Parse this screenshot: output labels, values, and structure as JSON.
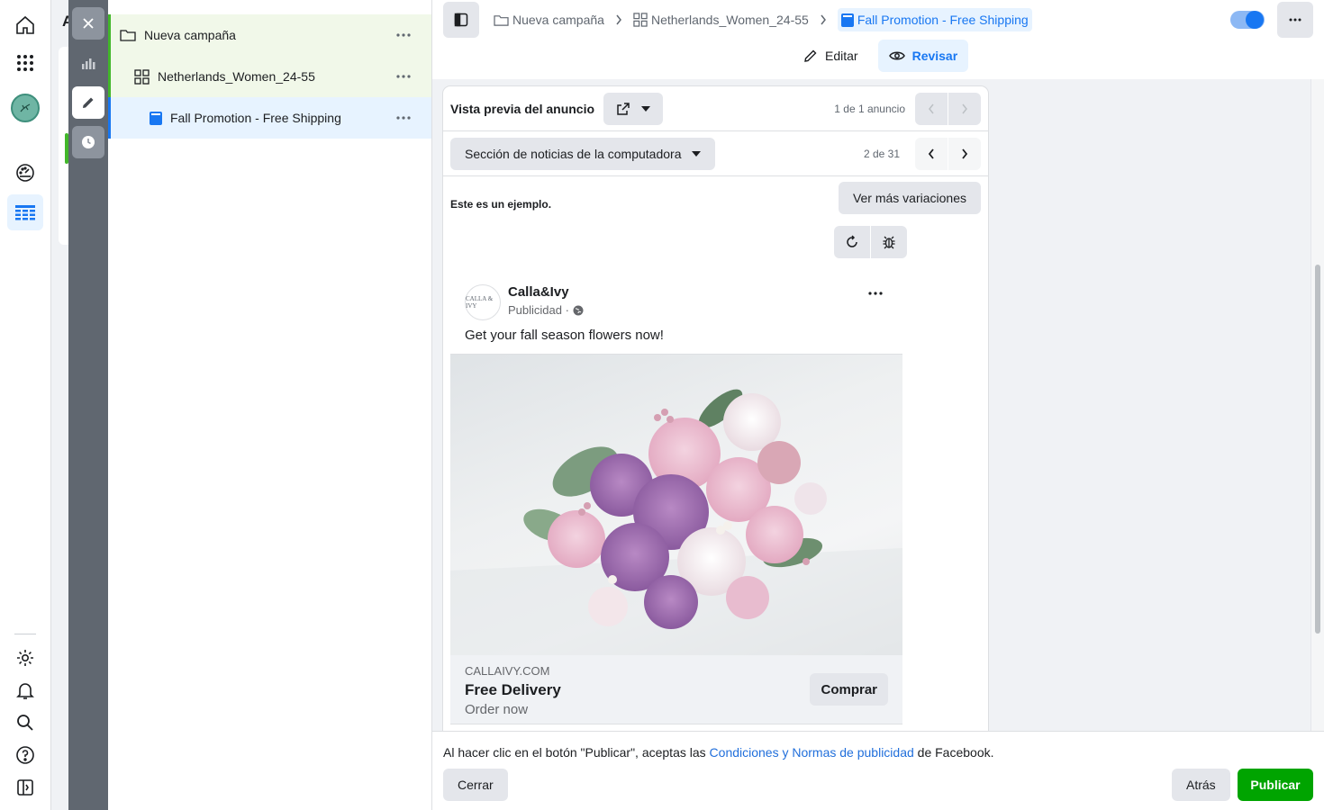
{
  "tree": {
    "items": [
      {
        "label": "Nueva campaña",
        "type": "campaign"
      },
      {
        "label": "Netherlands_Women_24-55",
        "type": "adset"
      },
      {
        "label": "Fall Promotion - Free Shipping",
        "type": "ad"
      }
    ]
  },
  "breadcrumbs": [
    "Nueva campaña",
    "Netherlands_Women_24-55",
    "Fall Promotion - Free Shipping"
  ],
  "tabs": {
    "edit": "Editar",
    "review": "Revisar"
  },
  "toggle": {
    "state": "on"
  },
  "preview": {
    "title": "Vista previa del anuncio",
    "count": "1 de 1 anuncio",
    "placement": "Sección de noticias de la computadora",
    "placement_count": "2 de 31",
    "sample_text": "Este es un ejemplo.",
    "more_variations": "Ver más variaciones"
  },
  "post": {
    "page_name": "Calla&Ivy",
    "logo_text": "CALLA & IVY",
    "sponsored": "Publicidad ·",
    "text": "Get your fall season flowers now!",
    "domain": "CALLAIVY.COM",
    "headline": "Free Delivery",
    "description": "Order now",
    "cta": "Comprar"
  },
  "footer": {
    "terms_before": "Al hacer clic en el botón \"Publicar\", aceptas las ",
    "terms_link": "Condiciones y Normas de publicidad",
    "terms_after": " de Facebook.",
    "close": "Cerrar",
    "back": "Atrás",
    "publish": "Publicar"
  },
  "bg_letter": "A",
  "colors": {
    "accent": "#1877f2",
    "publish": "#00a400",
    "campaign_highlight": "#f1f8e9"
  }
}
